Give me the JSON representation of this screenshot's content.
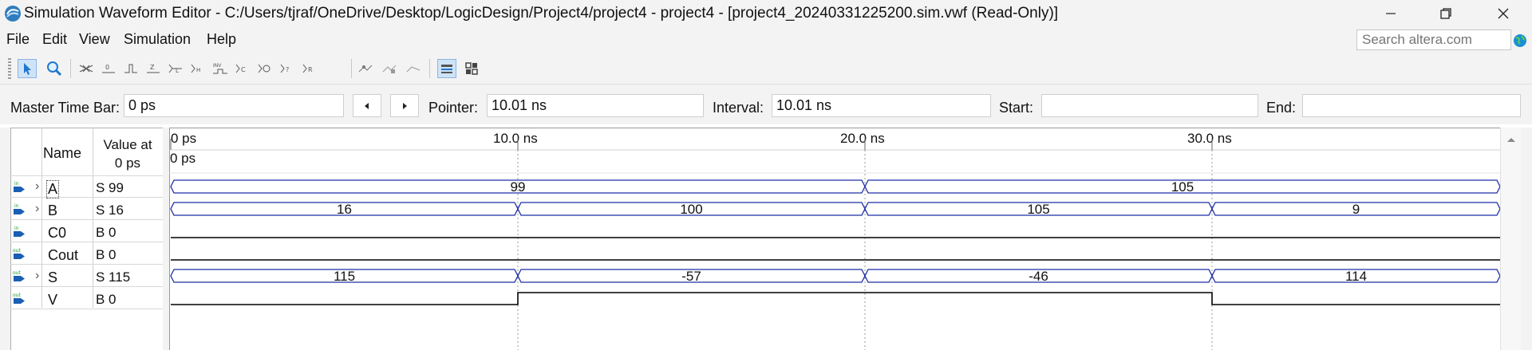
{
  "window": {
    "title": "Simulation Waveform Editor - C:/Users/tjraf/OneDrive/Desktop/LogicDesign/Project4/project4 - project4 - [project4_20240331225200.sim.vwf (Read-Only)]",
    "minimize_icon": "minimize-icon",
    "restore_icon": "restore-icon",
    "close_icon": "close-icon"
  },
  "menu": {
    "items": [
      "File",
      "Edit",
      "View",
      "Simulation",
      "Help"
    ]
  },
  "search": {
    "placeholder": "Search altera.com"
  },
  "toolbar": {
    "icons": [
      "selection-tool-icon",
      "zoom-tool-icon",
      "force-unknown-icon",
      "force-low-icon",
      "force-high-icon",
      "force-high-impedance-icon",
      "force-weak-low-icon",
      "force-weak-high-icon",
      "invert-icon",
      "count-value-icon",
      "overwrite-clock-icon",
      "random-values-icon",
      "arbitrary-value-icon",
      "overwrite-value-icon",
      "snap-to-grid-icon",
      "group-icon",
      "ungroup-icon",
      "set-grid-icon",
      "node-finder-icon"
    ]
  },
  "timebar": {
    "master_label": "Master Time Bar:",
    "master_value": "0 ps",
    "pointer_label": "Pointer:",
    "pointer_value": "10.01 ns",
    "interval_label": "Interval:",
    "interval_value": "10.01 ns",
    "start_label": "Start:",
    "start_value": "",
    "end_label": "End:",
    "end_value": ""
  },
  "table": {
    "name_header": "Name",
    "value_header_line1": "Value at",
    "value_header_line2": "0 ps",
    "signals": [
      {
        "name": "A",
        "type": "in",
        "value": "S 99",
        "bus": true
      },
      {
        "name": "B",
        "type": "in",
        "value": "S 16",
        "bus": true
      },
      {
        "name": "C0",
        "type": "in",
        "value": "B 0",
        "bus": false
      },
      {
        "name": "Cout",
        "type": "out",
        "value": "B 0",
        "bus": false
      },
      {
        "name": "S",
        "type": "out",
        "value": "S 115",
        "bus": true
      },
      {
        "name": "V",
        "type": "out",
        "value": "B 0",
        "bus": false
      }
    ]
  },
  "timeline": {
    "ticks": [
      "0 ps",
      "10.0 ns",
      "20.0 ns",
      "30.0 ns"
    ],
    "tick_values_ns": [
      0,
      10,
      20,
      30
    ],
    "cursor_label": "0 ps",
    "visible_end_ns": 38.3
  },
  "waveforms": {
    "A": {
      "kind": "bus",
      "segments": [
        {
          "start": 0,
          "end": 20,
          "label": "99"
        },
        {
          "start": 20,
          "end": 38.3,
          "label": "105"
        }
      ]
    },
    "B": {
      "kind": "bus",
      "segments": [
        {
          "start": 0,
          "end": 10,
          "label": "16"
        },
        {
          "start": 10,
          "end": 20,
          "label": "100"
        },
        {
          "start": 20,
          "end": 30,
          "label": "105"
        },
        {
          "start": 30,
          "end": 38.3,
          "label": "9"
        }
      ]
    },
    "C0": {
      "kind": "bit",
      "levels": [
        {
          "start": 0,
          "end": 38.3,
          "level": 0
        }
      ]
    },
    "Cout": {
      "kind": "bit",
      "levels": [
        {
          "start": 0,
          "end": 38.3,
          "level": 0
        }
      ]
    },
    "S": {
      "kind": "bus",
      "segments": [
        {
          "start": 0,
          "end": 10,
          "label": "115"
        },
        {
          "start": 10,
          "end": 20,
          "label": "-57"
        },
        {
          "start": 20,
          "end": 30,
          "label": "-46"
        },
        {
          "start": 30,
          "end": 38.3,
          "label": "114"
        }
      ]
    },
    "V": {
      "kind": "bit",
      "levels": [
        {
          "start": 0,
          "end": 10,
          "level": 0
        },
        {
          "start": 10,
          "end": 30,
          "level": 1
        },
        {
          "start": 30,
          "end": 38.3,
          "level": 0
        }
      ]
    }
  },
  "colors": {
    "bus": "#1f2fa8",
    "bit": "#000000",
    "grid": "#9a9a9a",
    "accent": "#1e78d0"
  }
}
